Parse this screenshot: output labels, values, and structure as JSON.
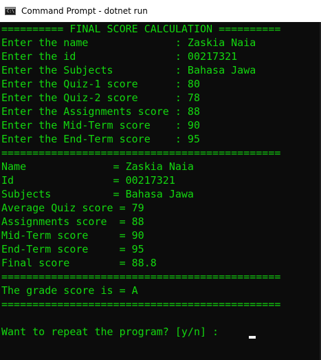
{
  "window": {
    "title": "Command Prompt - dotnet  run",
    "icon_glyph": "C:\\"
  },
  "colors": {
    "console_text": "#13d70f",
    "console_background": "#0c0c0c",
    "titlebar_background": "#ffffff"
  },
  "console": {
    "lines": [
      "========== FINAL SCORE CALCULATION ==========",
      "Enter the name              : Zaskia Naia",
      "Enter the id                : 00217321",
      "Enter the Subjects          : Bahasa Jawa",
      "Enter the Quiz-1 score      : 80",
      "Enter the Quiz-2 score      : 78",
      "Enter the Assignments score : 88",
      "Enter the Mid-Term score    : 90",
      "Enter the End-Term score    : 95",
      "=============================================",
      "Name              = Zaskia Naia",
      "Id                = 00217321",
      "Subjects          = Bahasa Jawa",
      "Average Quiz score = 79",
      "Assignments score  = 88",
      "Mid-Term score     = 90",
      "End-Term score     = 95",
      "Final score        = 88.8",
      "=============================================",
      "The grade score is = A",
      "=============================================",
      "",
      "Want to repeat the program? [y/n] : "
    ]
  }
}
